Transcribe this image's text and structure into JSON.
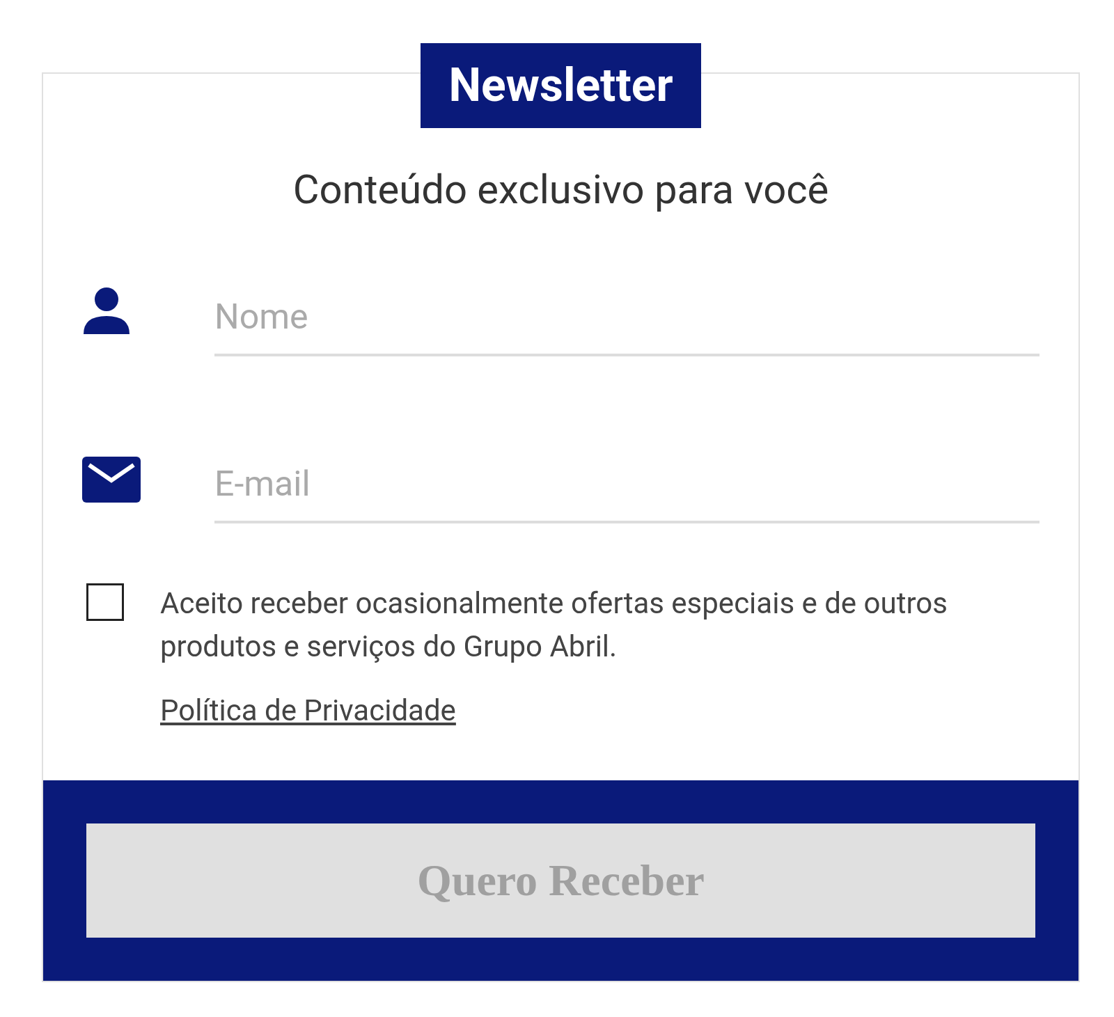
{
  "title": "Newsletter",
  "subtitle": "Conteúdo exclusivo para você",
  "fields": [
    {
      "kind": "name",
      "placeholder": "Nome"
    },
    {
      "kind": "email",
      "placeholder": "E-mail"
    }
  ],
  "consent": {
    "checked": false,
    "text": "Aceito receber ocasionalmente ofertas especiais e de outros produtos e serviços do Grupo Abril."
  },
  "privacy_link": "Política de Privacidade",
  "submit": {
    "label": "Quero Receber",
    "disabled": true
  }
}
